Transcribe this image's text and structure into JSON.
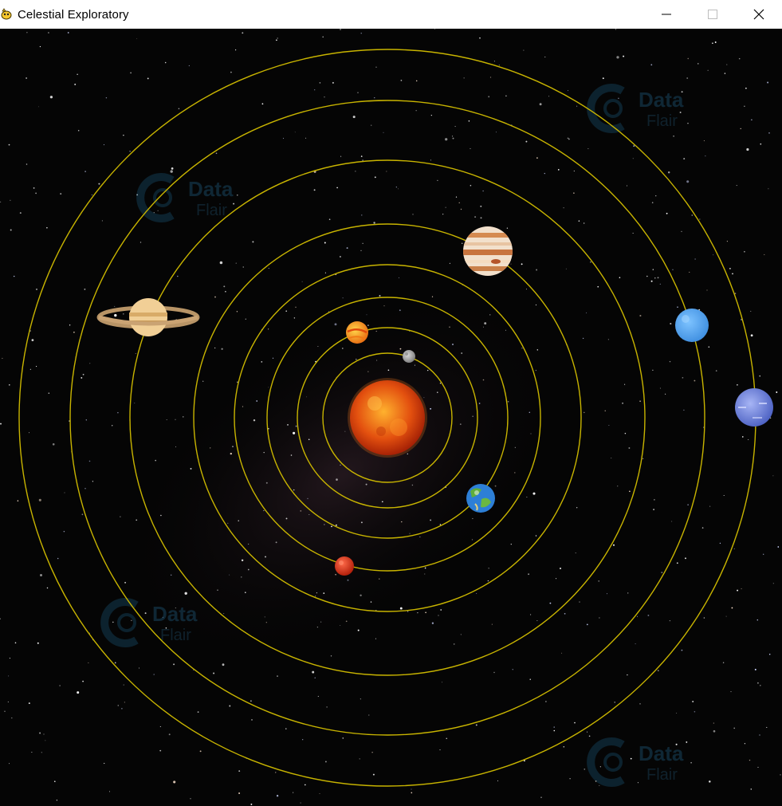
{
  "window": {
    "title": "Celestial Exploratory",
    "controls": [
      "minimize-icon",
      "maximize-icon",
      "close-icon"
    ]
  },
  "scene": {
    "background_color": "#050505",
    "orbit_color": "#c8b400",
    "watermark_text": [
      "Data",
      "Flair"
    ],
    "sun": {
      "name": "sun",
      "colors": [
        "#ffb22e",
        "#e3500f",
        "#a11e05"
      ]
    },
    "planets": [
      {
        "name": "mercury",
        "icon": "mercury-icon",
        "colors": [
          "#d8d8d8",
          "#7a7a7a"
        ]
      },
      {
        "name": "venus",
        "icon": "venus-icon",
        "colors": [
          "#ffd54a",
          "#e86a10"
        ]
      },
      {
        "name": "earth",
        "icon": "earth-icon",
        "colors": [
          "#2d7fd6",
          "#5fae3a"
        ]
      },
      {
        "name": "mars",
        "icon": "mars-icon",
        "colors": [
          "#ff6b4a",
          "#b3200b"
        ]
      },
      {
        "name": "jupiter",
        "icon": "jupiter-icon",
        "colors": [
          "#f2e0cc",
          "#c8743e"
        ]
      },
      {
        "name": "saturn",
        "icon": "saturn-icon",
        "colors": [
          "#f1cf96",
          "#b9873e"
        ]
      },
      {
        "name": "uranus",
        "icon": "uranus-icon",
        "colors": [
          "#7ec3ff",
          "#3e8ee0"
        ]
      },
      {
        "name": "neptune",
        "icon": "neptune-icon",
        "colors": [
          "#8c9ef0",
          "#4b60c2"
        ]
      }
    ]
  }
}
